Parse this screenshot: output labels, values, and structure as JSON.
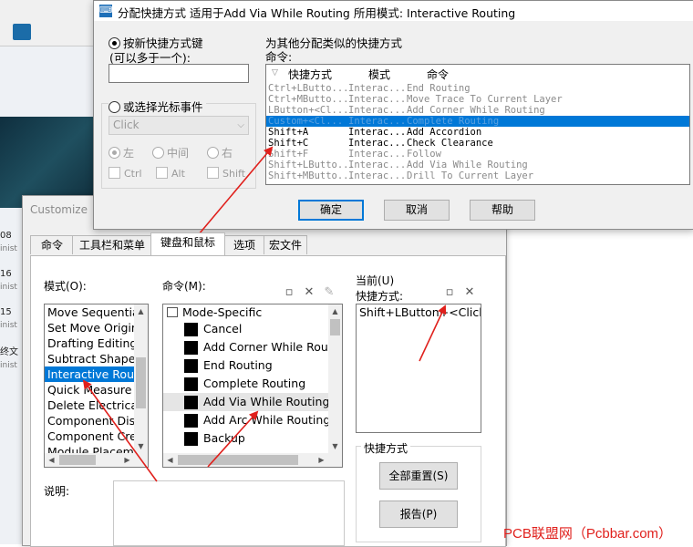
{
  "background": {
    "rows": [
      {
        "num": "08",
        "sub": "inist"
      },
      {
        "num": "16",
        "sub": "inist"
      },
      {
        "num": "15",
        "sub": "inist"
      },
      {
        "num": "终文",
        "sub": "inist"
      }
    ]
  },
  "customize": {
    "title": "Customize",
    "tabs": [
      "命令",
      "工具栏和菜单",
      "键盘和鼠标",
      "选项",
      "宏文件"
    ],
    "mode_label": "模式(O):",
    "modes": [
      "Move Sequentia",
      "Set Move Origin",
      "Drafting Editing",
      "Subtract Shapes",
      "Interactive Routi",
      "Quick Measure",
      "Delete Electrical",
      "Component Disa",
      "Component Cre",
      "Module Placeme"
    ],
    "selected_mode_index": 4,
    "commands_label": "命令(M):",
    "command_group": "Mode-Specific",
    "commands": [
      "Cancel",
      "Add Corner While Rout",
      "End Routing",
      "Complete Routing",
      "Add Via While Routing",
      "Add Arc While Routing",
      "Backup"
    ],
    "highlighted_command_index": 4,
    "current_label": "当前(U)",
    "shortcut_label": "快捷方式:",
    "current_shortcut": "Shift+LButton+<Click>",
    "shortcut_group_label": "快捷方式",
    "reset_all_label": "全部重置(S)",
    "report_label": "报告(P)",
    "description_label": "说明:"
  },
  "assign": {
    "title": "分配快捷方式 适用于Add Via While Routing 所用模式: Interactive Routing",
    "new_key_label": "按新快捷方式键",
    "new_key_sub": "(可以多于一个):",
    "new_key_value": "",
    "mouse_event_label": "或选择光标事件",
    "mouse_event_value": "Click",
    "left_label": "左",
    "middle_label": "中间",
    "right_label": "右",
    "ctrl_label": "Ctrl",
    "alt_label": "Alt",
    "shift_label": "Shift",
    "similar_label": "为其他分配类似的快捷方式",
    "commands_label": "命令:",
    "col_shortcut": "快捷方式",
    "col_mode": "模式",
    "col_command": "命令",
    "rows": [
      {
        "key": "Ctrl+LButto...",
        "mode": "Interac...",
        "cmd": "End Routing",
        "state": "gray"
      },
      {
        "key": "Ctrl+MButto...",
        "mode": "Interac...",
        "cmd": "Move Trace To Current Layer",
        "state": "gray"
      },
      {
        "key": "LButton+<Cl...",
        "mode": "Interac...",
        "cmd": "Add Corner While Routing",
        "state": "gray"
      },
      {
        "key": "Custom+<Cl...",
        "mode": "Interac...",
        "cmd": "Complete Routing",
        "state": "sel"
      },
      {
        "key": "Shift+A",
        "mode": "Interac...",
        "cmd": "Add Accordion",
        "state": "normal"
      },
      {
        "key": "Shift+C",
        "mode": "Interac...",
        "cmd": "Check Clearance",
        "state": "normal"
      },
      {
        "key": "Shift+F",
        "mode": "Interac...",
        "cmd": "Follow",
        "state": "gray"
      },
      {
        "key": "Shift+LButto...",
        "mode": "Interac...",
        "cmd": "Add Via While Routing",
        "state": "gray"
      },
      {
        "key": "Shift+MButto...",
        "mode": "Interac...",
        "cmd": "Drill To Current Layer",
        "state": "gray"
      }
    ],
    "ok_label": "确定",
    "cancel_label": "取消",
    "help_label": "帮助"
  },
  "footer": "PCB联盟网（Pcbbar.com）",
  "colors": {
    "accent": "#0078d7",
    "arrow": "#e0201c"
  }
}
